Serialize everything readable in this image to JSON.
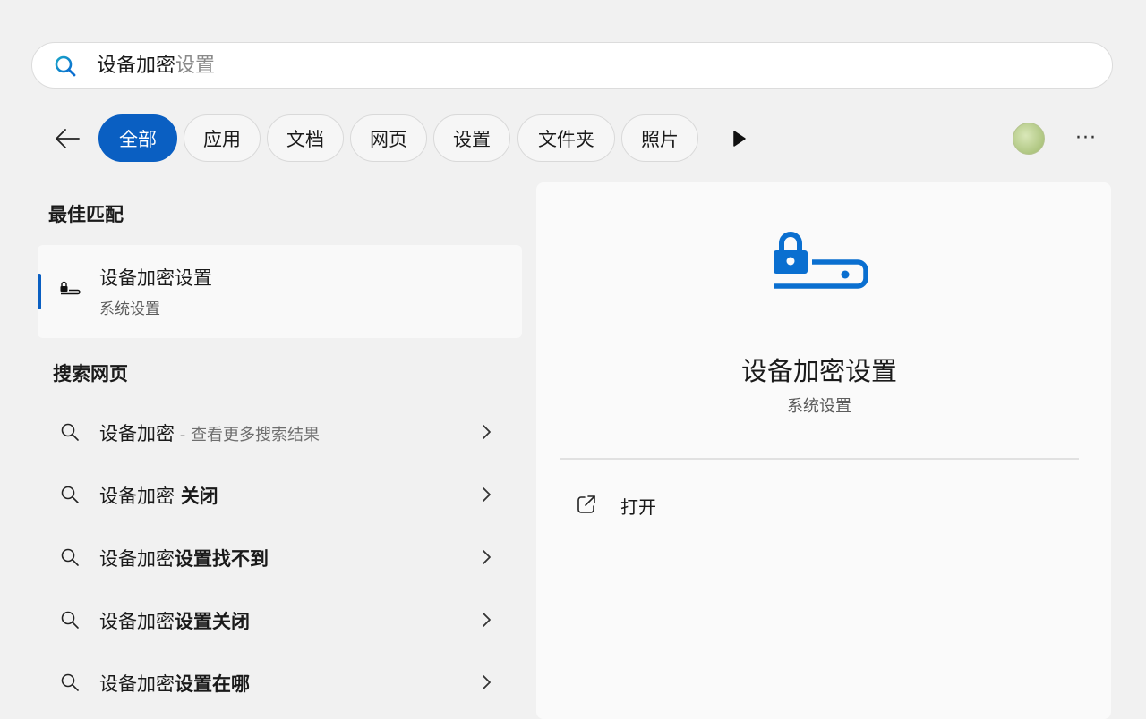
{
  "search": {
    "typed": "设备加密",
    "suggestion": "设置"
  },
  "filters": {
    "chips": [
      "全部",
      "应用",
      "文档",
      "网页",
      "设置",
      "文件夹",
      "照片"
    ],
    "active_index": 0,
    "accent_color": "#0a5fc2"
  },
  "best_match": {
    "heading": "最佳匹配",
    "title": "设备加密设置",
    "subtitle": "系统设置",
    "icon": "device-encryption-icon"
  },
  "web_search": {
    "heading": "搜索网页",
    "results": [
      {
        "prefix": "设备加密",
        "bold": "",
        "muted": " - 查看更多搜索结果"
      },
      {
        "prefix": "设备加密 ",
        "bold": "关闭",
        "muted": ""
      },
      {
        "prefix": "设备加密",
        "bold": "设置找不到",
        "muted": ""
      },
      {
        "prefix": "设备加密",
        "bold": "设置关闭",
        "muted": ""
      },
      {
        "prefix": "设备加密",
        "bold": "设置在哪",
        "muted": ""
      }
    ]
  },
  "preview": {
    "title": "设备加密设置",
    "subtitle": "系统设置",
    "actions": [
      {
        "label": "打开",
        "icon": "open-external-icon"
      }
    ]
  }
}
